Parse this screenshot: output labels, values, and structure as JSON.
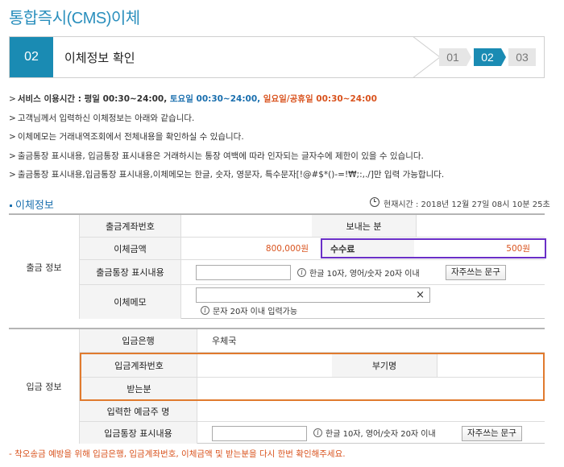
{
  "page_title": "통합즉시(CMS)이체",
  "step": {
    "number": "02",
    "label": "이체정보 확인",
    "sequence": [
      "01",
      "02",
      "03"
    ],
    "active_index": 1
  },
  "notices": [
    {
      "prefix": "서비스 이용시간 : 평일 00:30~24:00, ",
      "saturday": "토요일 00:30~24:00,",
      "holiday": " 일요일/공휴일 00:30~24:00"
    },
    {
      "text": "고객님께서 입력하신 이체정보는 아래와 같습니다."
    },
    {
      "text": "이체메모는 거래내역조회에서 전체내용을 확인하실 수 있습니다."
    },
    {
      "text": "출금통장 표시내용, 입금통장 표시내용은 거래하시는 통장 여백에 따라 인자되는 글자수에 제한이 있을 수 있습니다."
    },
    {
      "text": "출금통장 표시내용,입금통장 표시내용,이체메모는 한글, 숫자, 영문자, 특수문자[!@#$*()-=!₩;:,./]만 입력 가능합니다."
    }
  ],
  "section": {
    "title": "이체정보",
    "current_time": "현재시간 : 2018년 12월 27일 08시 10분 25초"
  },
  "withdraw": {
    "group_label": "출금 정보",
    "account_label": "출금계좌번호",
    "sender_label": "보내는 분",
    "amount_label": "이체금액",
    "amount_value": "800,000원",
    "fee_label": "수수료",
    "fee_value": "500원",
    "passbook_label": "출금통장 표시내용",
    "passbook_hint": "한글 10자, 영어/숫자 20자 이내",
    "passbook_button": "자주쓰는 문구",
    "memo_label": "이체메모",
    "memo_hint": "문자 20자 이내 입력가능",
    "memo_clear": "×"
  },
  "deposit": {
    "group_label": "입금 정보",
    "bank_label": "입금은행",
    "bank_value": "우체국",
    "account_label": "입금계좌번호",
    "extra_label": "부기명",
    "receiver_label": "받는분",
    "holder_label": "입력한 예금주 명",
    "passbook_label": "입금통장 표시내용",
    "passbook_hint": "한글 10자, 영어/숫자 20자 이내",
    "passbook_button": "자주쓰는 문구"
  },
  "footer_note": "- 착오송금 예방을 위해 입금은행, 입금계좌번호, 이체금액 및 받는분을 다시 한번 확인해주세요.",
  "colors": {
    "brand": "#1a8bb3",
    "accent_orange": "#d9531e",
    "highlight_purple": "#6a2fc7",
    "highlight_orange": "#e07a2e"
  }
}
